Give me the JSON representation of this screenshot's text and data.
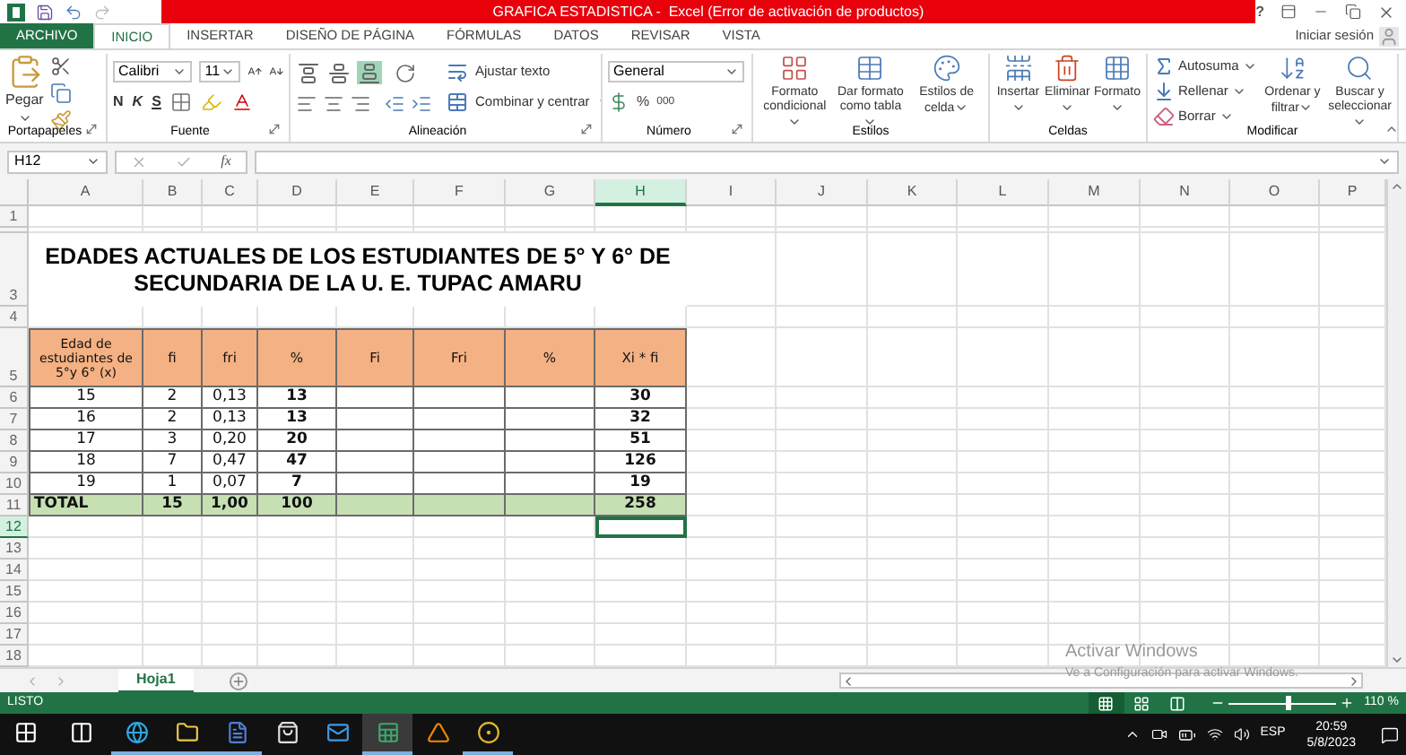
{
  "title_bar": {
    "title": "GRAFICA ESTADISTICA -  Excel (Error de activación de productos)",
    "help": "?"
  },
  "ribbon_tabs": [
    {
      "label": "ARCHIVO",
      "kind": "file",
      "selected": false
    },
    {
      "label": "INICIO",
      "kind": "tab",
      "selected": true
    },
    {
      "label": "INSERTAR",
      "kind": "tab",
      "selected": false
    },
    {
      "label": "DISEÑO DE PÁGINA",
      "kind": "tab",
      "selected": false
    },
    {
      "label": "FÓRMULAS",
      "kind": "tab",
      "selected": false
    },
    {
      "label": "DATOS",
      "kind": "tab",
      "selected": false
    },
    {
      "label": "REVISAR",
      "kind": "tab",
      "selected": false
    },
    {
      "label": "VISTA",
      "kind": "tab",
      "selected": false
    }
  ],
  "sign_in": "Iniciar sesión",
  "ribbon_groups": [
    {
      "kind": "clipboard",
      "label": "Portapapeles",
      "launcher": true,
      "paste": "Pegar"
    },
    {
      "kind": "font",
      "label": "Fuente",
      "launcher": true,
      "font": "Calibri",
      "size": "11",
      "bold": "N",
      "italic": "K",
      "underline": "S"
    },
    {
      "kind": "alignment",
      "label": "Alineación",
      "launcher": true,
      "wrap": "Ajustar texto",
      "merge": "Combinar y centrar",
      "vertical_align": [
        {
          "selected": false
        },
        {
          "selected": false
        },
        {
          "selected": true
        }
      ]
    },
    {
      "kind": "number",
      "label": "Número",
      "launcher": true,
      "format": "General",
      "percent": "%",
      "thousands": "000"
    },
    {
      "kind": "styles",
      "label": "Estilos",
      "buttons": [
        {
          "label": "Formato condicional"
        },
        {
          "label": "Dar formato como tabla"
        },
        {
          "label": "Estilos de celda"
        }
      ]
    },
    {
      "kind": "cells",
      "label": "Celdas",
      "buttons": [
        {
          "label": "Insertar"
        },
        {
          "label": "Eliminar"
        },
        {
          "label": "Formato"
        }
      ]
    },
    {
      "kind": "editing",
      "label": "Modificar",
      "small": [
        {
          "label": "Autosuma"
        },
        {
          "label": "Rellenar"
        },
        {
          "label": "Borrar"
        }
      ],
      "buttons": [
        {
          "label": "Ordenar y filtrar"
        },
        {
          "label": "Buscar y seleccionar"
        }
      ]
    }
  ],
  "name_box": "H12",
  "function_label": "fx",
  "columns": [
    {
      "label": "A",
      "selected": false
    },
    {
      "label": "B",
      "selected": false
    },
    {
      "label": "C",
      "selected": false
    },
    {
      "label": "D",
      "selected": false
    },
    {
      "label": "E",
      "selected": false
    },
    {
      "label": "F",
      "selected": false
    },
    {
      "label": "G",
      "selected": false
    },
    {
      "label": "H",
      "selected": true
    },
    {
      "label": "I",
      "selected": false
    },
    {
      "label": "J",
      "selected": false
    },
    {
      "label": "K",
      "selected": false
    },
    {
      "label": "L",
      "selected": false
    },
    {
      "label": "M",
      "selected": false
    },
    {
      "label": "N",
      "selected": false
    },
    {
      "label": "O",
      "selected": false
    },
    {
      "label": "P",
      "selected": false
    }
  ],
  "rows": [
    {
      "number": "1",
      "kind": "empty",
      "selected": false
    },
    {
      "kind": "hidden",
      "selected": false
    },
    {
      "number": "3",
      "kind": "title",
      "selected": false,
      "text": "EDADES ACTUALES DE LOS ESTUDIANTES DE 5° Y 6° DE SECUNDARIA DE LA U. E. TUPAC AMARU"
    },
    {
      "number": "4",
      "kind": "empty",
      "selected": false
    },
    {
      "number": "5",
      "kind": "header",
      "selected": false,
      "cells": [
        "Edad de estudiantes de 5°y 6° (x)",
        "fi",
        "fri",
        "%",
        "Fi",
        "Fri",
        "%",
        "Xi * fi"
      ]
    },
    {
      "number": "6",
      "kind": "data",
      "selected": false,
      "cells": [
        "15",
        "2",
        "0,13",
        "13",
        null,
        null,
        null,
        "30"
      ]
    },
    {
      "number": "7",
      "kind": "data",
      "selected": false,
      "cells": [
        "16",
        "2",
        "0,13",
        "13",
        null,
        null,
        null,
        "32"
      ]
    },
    {
      "number": "8",
      "kind": "data",
      "selected": false,
      "cells": [
        "17",
        "3",
        "0,20",
        "20",
        null,
        null,
        null,
        "51"
      ]
    },
    {
      "number": "9",
      "kind": "data",
      "selected": false,
      "cells": [
        "18",
        "7",
        "0,47",
        "47",
        null,
        null,
        null,
        "126"
      ]
    },
    {
      "number": "10",
      "kind": "data",
      "selected": false,
      "cells": [
        "19",
        "1",
        "0,07",
        "7",
        null,
        null,
        null,
        "19"
      ]
    },
    {
      "number": "11",
      "kind": "total",
      "selected": false,
      "cells": [
        "TOTAL",
        "15",
        "1,00",
        "100",
        null,
        null,
        null,
        "258"
      ]
    },
    {
      "number": "12",
      "kind": "empty",
      "selected": true
    },
    {
      "number": "13",
      "kind": "empty",
      "selected": false
    },
    {
      "number": "14",
      "kind": "empty",
      "selected": false
    },
    {
      "number": "15",
      "kind": "empty",
      "selected": false
    },
    {
      "number": "16",
      "kind": "empty",
      "selected": false
    },
    {
      "number": "17",
      "kind": "empty",
      "selected": false
    },
    {
      "number": "18",
      "kind": "empty",
      "selected": false
    }
  ],
  "sheets": [
    {
      "label": "Hoja1",
      "selected": true
    }
  ],
  "activation_notice": {
    "title": "Activar Windows",
    "text": "Ve a Configuración para activar Windows."
  },
  "status_bar": {
    "status": "LISTO",
    "views": [
      {
        "selected": true
      },
      {
        "selected": false
      },
      {
        "selected": false
      }
    ],
    "zoom": {
      "level": 0.55,
      "reading": "110 %"
    }
  },
  "taskbar": {
    "apps": [
      {
        "kind": "start",
        "running": false,
        "selected": false
      },
      {
        "kind": "task_view",
        "running": false,
        "selected": false
      },
      {
        "kind": "browser",
        "running": true,
        "selected": false
      },
      {
        "kind": "folder",
        "running": true,
        "selected": false
      },
      {
        "kind": "document",
        "running": true,
        "selected": false
      },
      {
        "kind": "store",
        "running": false,
        "selected": false
      },
      {
        "kind": "mail",
        "running": false,
        "selected": false
      },
      {
        "kind": "spreadsheet",
        "running": true,
        "selected": true
      },
      {
        "kind": "cone",
        "running": false,
        "selected": false
      },
      {
        "kind": "chrome",
        "running": true,
        "selected": false
      }
    ],
    "language": "ESP",
    "time": "20:59",
    "date": "5/8/2023"
  }
}
